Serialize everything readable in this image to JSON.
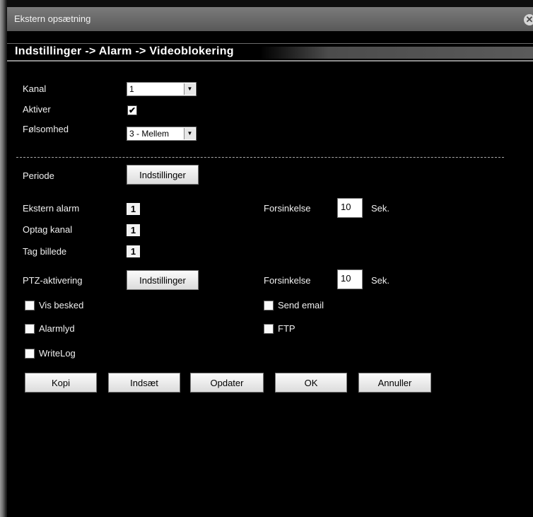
{
  "window": {
    "title": "Ekstern opsætning",
    "close_glyph": "✕"
  },
  "header": {
    "breadcrumb": "Indstillinger -> Alarm -> Videoblokering"
  },
  "form": {
    "kanal": {
      "label": "Kanal",
      "value": "1"
    },
    "aktiver": {
      "label": "Aktiver",
      "checked": true,
      "mark": "✔"
    },
    "folsomhed": {
      "label": "Følsomhed",
      "value": "3 - Mellem"
    },
    "periode": {
      "label": "Periode",
      "button": "Indstillinger"
    },
    "ekstern_alarm": {
      "label": "Ekstern alarm",
      "channel": "1"
    },
    "forsinkelse1": {
      "label": "Forsinkelse",
      "value": "10",
      "unit": "Sek."
    },
    "optag_kanal": {
      "label": "Optag kanal",
      "channel": "1"
    },
    "tag_billede": {
      "label": "Tag billede",
      "channel": "1"
    },
    "ptz": {
      "label": "PTZ-aktivering",
      "button": "Indstillinger"
    },
    "forsinkelse2": {
      "label": "Forsinkelse",
      "value": "10",
      "unit": "Sek."
    },
    "vis_besked": {
      "label": "Vis besked",
      "checked": false
    },
    "send_email": {
      "label": "Send email",
      "checked": false
    },
    "alarmlyd": {
      "label": "Alarmlyd",
      "checked": false
    },
    "ftp": {
      "label": "FTP",
      "checked": false
    },
    "writelog": {
      "label": "WriteLog",
      "checked": false
    }
  },
  "buttons": {
    "kopi": "Kopi",
    "indsaet": "Indsæt",
    "opdater": "Opdater",
    "ok": "OK",
    "annuller": "Annuller"
  },
  "icons": {
    "dropdown": "▼"
  }
}
